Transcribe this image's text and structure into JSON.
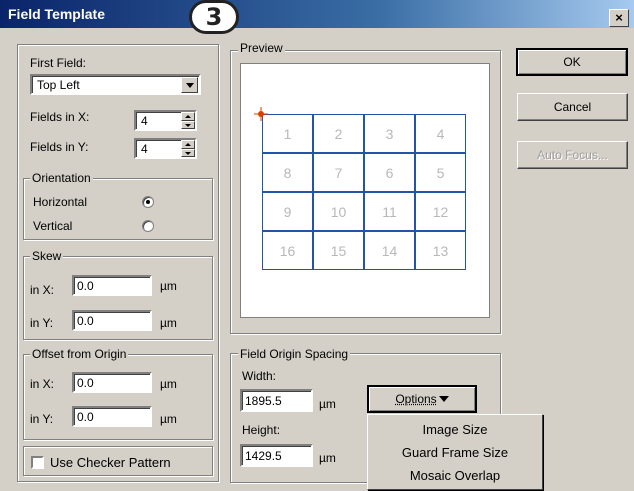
{
  "window": {
    "title": "Field Template",
    "step_number": "3",
    "close_glyph": "×"
  },
  "first_field": {
    "label": "First Field:",
    "value": "Top Left"
  },
  "fields_x": {
    "label": "Fields in X:",
    "value": "4"
  },
  "fields_y": {
    "label": "Fields in Y:",
    "value": "4"
  },
  "orientation": {
    "label": "Orientation",
    "options": [
      "Horizontal",
      "Vertical"
    ],
    "selected": "Horizontal"
  },
  "skew": {
    "label": "Skew",
    "x_label": "in X:",
    "x_value": "0.0",
    "y_label": "in Y:",
    "y_value": "0.0",
    "unit": "µm"
  },
  "offset": {
    "label": "Offset from Origin",
    "x_label": "in X:",
    "x_value": "0.0",
    "y_label": "in Y:",
    "y_value": "0.0",
    "unit": "µm"
  },
  "checker": {
    "label": "Use Checker Pattern",
    "checked": false
  },
  "preview": {
    "label": "Preview",
    "cells": [
      [
        "1",
        "2",
        "3",
        "4"
      ],
      [
        "8",
        "7",
        "6",
        "5"
      ],
      [
        "9",
        "10",
        "11",
        "12"
      ],
      [
        "16",
        "15",
        "14",
        "13"
      ]
    ],
    "grid_color": "#2255a8",
    "origin_marker_color": "#e03a00"
  },
  "spacing": {
    "label": "Field Origin Spacing",
    "width_label": "Width:",
    "width_value": "1895.5",
    "height_label": "Height:",
    "height_value": "1429.5",
    "unit": "µm",
    "options_label": "Options"
  },
  "options_menu": [
    "Image Size",
    "Guard Frame Size",
    "Mosaic Overlap"
  ],
  "buttons": {
    "ok": "OK",
    "cancel": "Cancel",
    "auto_focus": "Auto Focus..."
  }
}
